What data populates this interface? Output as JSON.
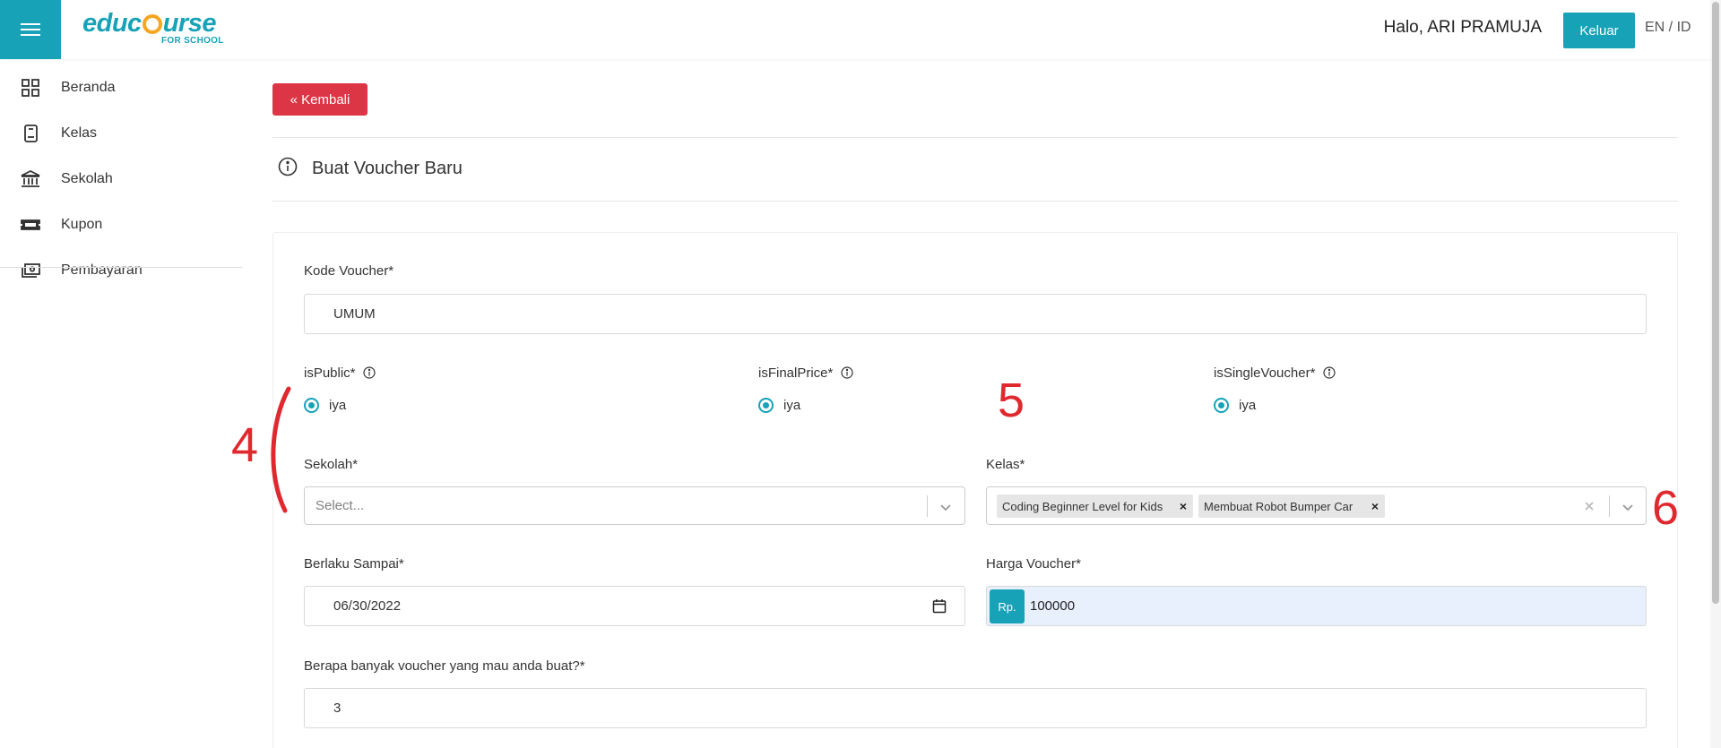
{
  "header": {
    "logo_text_a": "educ",
    "logo_text_b": "urse",
    "logo_sub": "FOR SCHOOL",
    "greeting": "Halo, ARI PRAMUJA",
    "logout_label": "Keluar",
    "language_toggle": "EN / ID",
    "brand_color": "#17a2b8"
  },
  "sidebar": {
    "items": [
      {
        "label": "Beranda",
        "icon": "grid-icon"
      },
      {
        "label": "Kelas",
        "icon": "book-icon"
      },
      {
        "label": "Sekolah",
        "icon": "institution-icon"
      },
      {
        "label": "Kupon",
        "icon": "ticket-icon"
      },
      {
        "label": "Pembayaran",
        "icon": "payment-icon"
      }
    ]
  },
  "main": {
    "back_label": "« Kembali",
    "section_title": "Buat Voucher Baru",
    "form": {
      "voucher_code_label": "Kode Voucher*",
      "voucher_code_value": "UMUM",
      "is_public_label": "isPublic*",
      "is_public_option": "iya",
      "is_final_price_label": "isFinalPrice*",
      "is_final_price_option": "iya",
      "is_single_voucher_label": "isSingleVoucher*",
      "is_single_voucher_option": "iya",
      "school_label": "Sekolah*",
      "school_placeholder": "Select...",
      "class_label": "Kelas*",
      "class_tags": [
        "Coding Beginner Level for Kids",
        "Membuat Robot Bumper Car"
      ],
      "valid_until_label": "Berlaku Sampai*",
      "valid_until_value": "06/30/2022",
      "price_label": "Harga Voucher*",
      "price_prefix": "Rp.",
      "price_value": "100000",
      "quantity_label": "Berapa banyak voucher yang mau anda buat?*",
      "quantity_value": "3"
    }
  },
  "annotations": {
    "mark_4": "4",
    "mark_5": "5",
    "mark_6": "6",
    "color": "#e0282f"
  }
}
